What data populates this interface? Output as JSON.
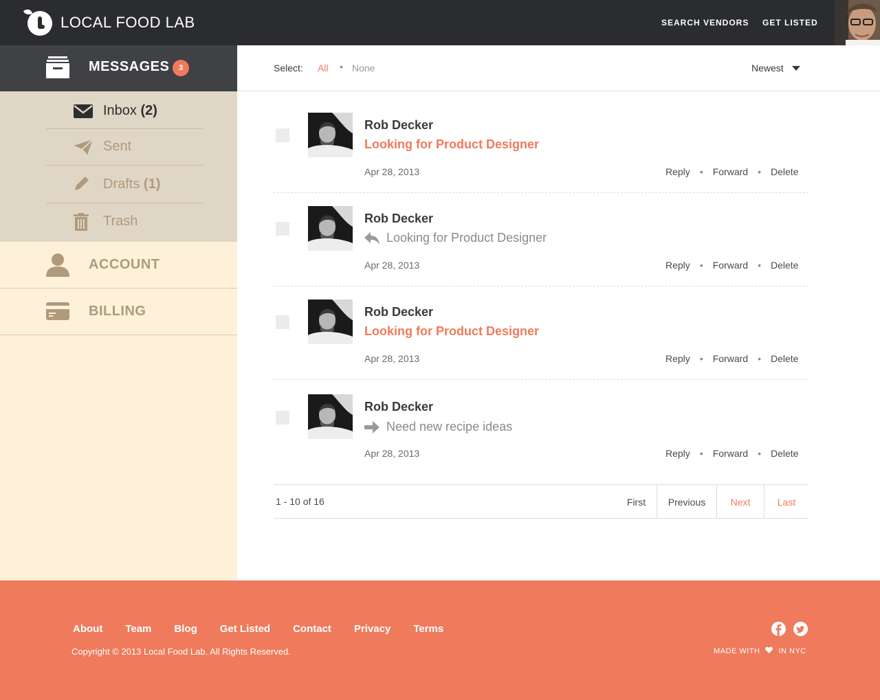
{
  "brand": {
    "name": "LOCAL FOOD LAB"
  },
  "topnav": {
    "search_vendors": "SEARCH VENDORS",
    "get_listed": "GET LISTED"
  },
  "sidebar": {
    "messages_label": "MESSAGES",
    "messages_count": "3",
    "folders": [
      {
        "label": "Inbox",
        "count": "(2)",
        "icon": "envelope-icon"
      },
      {
        "label": "Sent",
        "count": "",
        "icon": "paper-plane-icon"
      },
      {
        "label": "Drafts",
        "count": "(1)",
        "icon": "pencil-icon"
      },
      {
        "label": "Trash",
        "count": "",
        "icon": "trash-icon"
      }
    ],
    "account_label": "ACCOUNT",
    "billing_label": "BILLING"
  },
  "toolbar": {
    "select_label": "Select:",
    "all": "All",
    "none": "None",
    "sort": "Newest"
  },
  "messages": [
    {
      "sender": "Rob Decker",
      "subject": "Looking for Product Designer",
      "state": "unread",
      "date": "Apr 28, 2013"
    },
    {
      "sender": "Rob Decker",
      "subject": "Looking for Product Designer",
      "state": "replied",
      "date": "Apr 28, 2013"
    },
    {
      "sender": "Rob Decker",
      "subject": "Looking for Product Designer",
      "state": "unread",
      "date": "Apr 28, 2013"
    },
    {
      "sender": "Rob Decker",
      "subject": "Need new recipe ideas",
      "state": "forwarded",
      "date": "Apr 28, 2013"
    }
  ],
  "message_actions": {
    "reply": "Reply",
    "forward": "Forward",
    "delete": "Delete"
  },
  "pagination": {
    "range": "1 - 10 of 16",
    "first": "First",
    "previous": "Previous",
    "next": "Next",
    "last": "Last"
  },
  "footer": {
    "links": [
      "About",
      "Team",
      "Blog",
      "Get Listed",
      "Contact",
      "Privacy",
      "Terms"
    ],
    "copyright": "Copyright © 2013 Local Food Lab. All Rights Reserved.",
    "made_with": "MADE WITH",
    "in_nyc": "IN NYC"
  },
  "colors": {
    "accent": "#ef7a5c",
    "topbar": "#2b2c2f",
    "sidebar_bg": "#fdf1da",
    "submenu_bg": "#e0d6c6",
    "sidebar_text": "#b09a7c"
  }
}
